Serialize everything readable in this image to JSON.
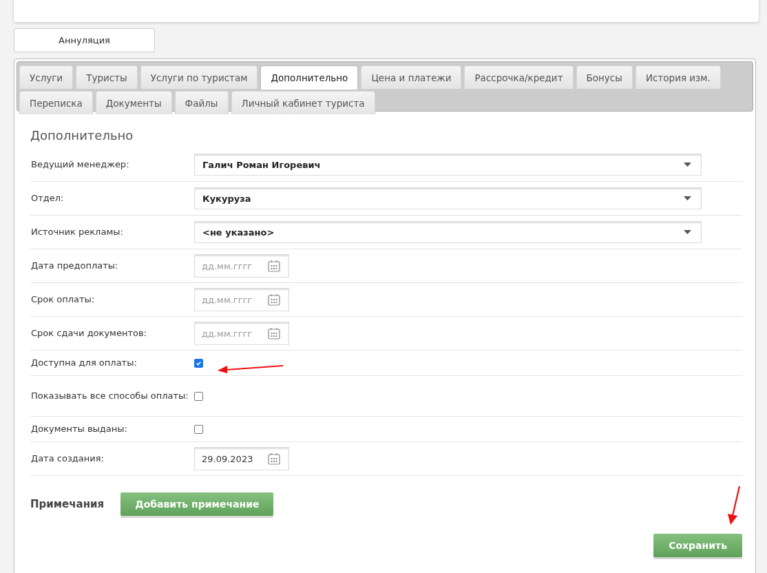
{
  "cancel_button": "Аннуляция",
  "tabs": [
    {
      "label": "Услуги",
      "selected": false
    },
    {
      "label": "Туристы",
      "selected": false
    },
    {
      "label": "Услуги по туристам",
      "selected": false
    },
    {
      "label": "Дополнительно",
      "selected": true
    },
    {
      "label": "Цена и платежи",
      "selected": false
    },
    {
      "label": "Рассрочка/кредит",
      "selected": false
    },
    {
      "label": "Бонусы",
      "selected": false
    },
    {
      "label": "История изм.",
      "selected": false
    },
    {
      "label": "Переписка",
      "selected": false
    },
    {
      "label": "Документы",
      "selected": false
    },
    {
      "label": "Файлы",
      "selected": false
    },
    {
      "label": "Личный кабинет туриста",
      "selected": false
    }
  ],
  "section_title": "Дополнительно",
  "fields": [
    {
      "kind": "select",
      "label": "Ведущий менеджер:",
      "value": "Галич Роман Игоревич"
    },
    {
      "kind": "select",
      "label": "Отдел:",
      "value": "Кукуруза"
    },
    {
      "kind": "select",
      "label": "Источник рекламы:",
      "value": "<не указано>"
    },
    {
      "kind": "date",
      "label": "Дата предоплаты:",
      "placeholder": "дд.мм.гггг"
    },
    {
      "kind": "date",
      "label": "Срок оплаты:",
      "placeholder": "дд.мм.гггг"
    },
    {
      "kind": "date",
      "label": "Срок сдачи документов:",
      "placeholder": "дд.мм.гггг"
    },
    {
      "kind": "checkbox",
      "label": "Доступна для оплаты:",
      "checked": true
    },
    {
      "kind": "checkbox",
      "label": "Показывать все способы оплаты:",
      "checked": false
    },
    {
      "kind": "checkbox",
      "label": "Документы выданы:",
      "checked": false
    },
    {
      "kind": "date",
      "label": "Дата создания:",
      "value": "29.09.2023"
    }
  ],
  "notes": {
    "title": "Примечания",
    "add_button": "Добавить примечание"
  },
  "save_button": "Сохранить"
}
